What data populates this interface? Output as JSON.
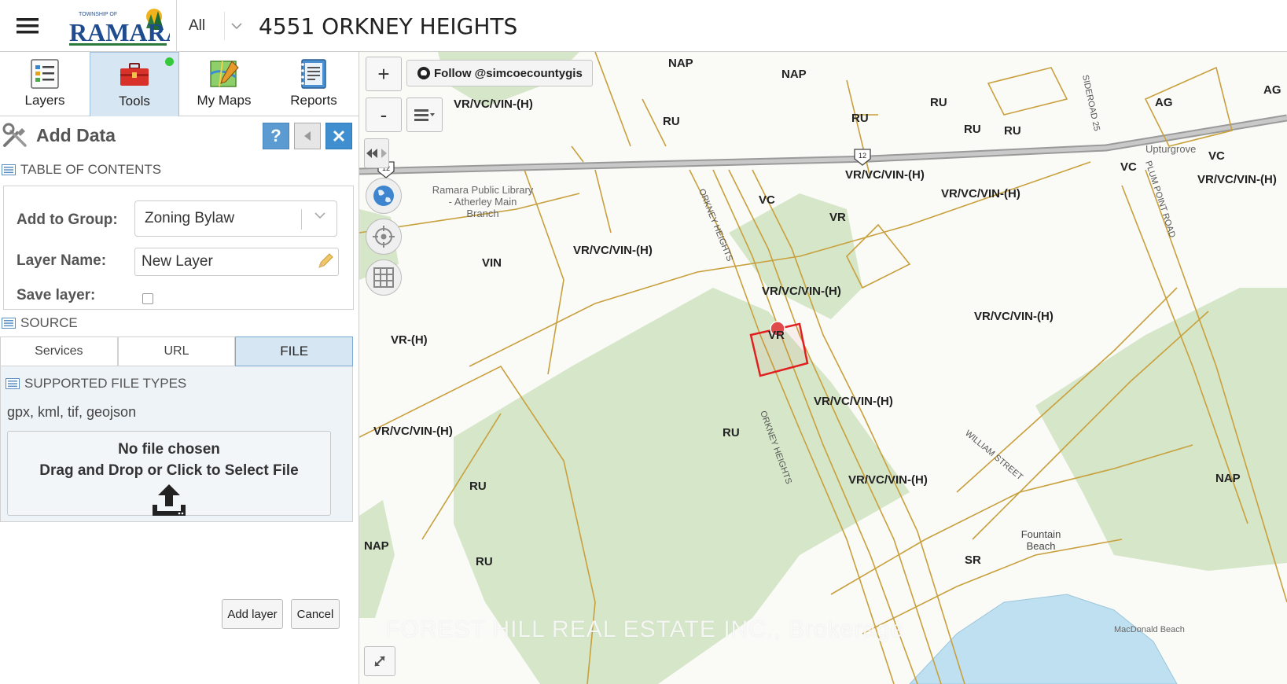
{
  "header": {
    "menu_icon": "hamburger-icon",
    "logo_top": "TOWNSHIP OF",
    "logo_name": "RAMARA",
    "search_scope": "All",
    "search_value": "4551 ORKNEY HEIGHTS"
  },
  "tabs": [
    {
      "label": "Layers",
      "icon": "layers-icon"
    },
    {
      "label": "Tools",
      "icon": "toolbox-icon"
    },
    {
      "label": "My Maps",
      "icon": "my-maps-icon"
    },
    {
      "label": "Reports",
      "icon": "reports-icon"
    }
  ],
  "panel": {
    "title": "Add Data",
    "help_label": "?",
    "toc_header": "TABLE OF CONTENTS",
    "add_to_group_label": "Add to Group:",
    "add_to_group_value": "Zoning Bylaw",
    "layer_name_label": "Layer Name:",
    "layer_name_value": "New Layer",
    "save_layer_label": "Save layer:",
    "source_header": "SOURCE",
    "source_tabs": [
      "Services",
      "URL",
      "FILE"
    ],
    "supported_header": "SUPPORTED FILE TYPES",
    "supported_types": "gpx, kml, tif, geojson",
    "dropzone_line1": "No file chosen",
    "dropzone_line2": "Drag and Drop or Click to Select File",
    "add_layer_button": "Add layer",
    "cancel_button": "Cancel"
  },
  "map": {
    "zoom_in": "+",
    "zoom_out": "-",
    "follow_label": "Follow @simcoecountygis",
    "watermark": "FOREST HILL REAL ESTATE INC., Brokerage",
    "highway_shield": "12",
    "places": [
      "Ramara Public Library - Atherley Main Branch",
      "Fountain Beach",
      "Upturgrove",
      "MacDonald Beach",
      "ORKNEY HEIGHTS",
      "SIDEROAD 25",
      "PLUM POINT ROAD",
      "WILLIAM STREET"
    ],
    "zone_labels": [
      "NAP",
      "NAP",
      "RU",
      "RU",
      "RU",
      "RU",
      "RU",
      "AG",
      "AG",
      "VR/VC/VIN-(H)",
      "VR/VC/VIN-(H)",
      "VR/VC/VIN-(H)",
      "VR/VC/VIN-(H)",
      "VR/VC/VIN-(H)",
      "VR/VC/VIN-(H)",
      "VR/VC/VIN-(H)",
      "VR/VC/VIN-(H)",
      "VR/VC/VIN-(H)",
      "VR/VC/VIN-(H)",
      "VIN",
      "VR-(H)",
      "VC",
      "VC",
      "VC",
      "VR",
      "RU",
      "RU",
      "RU",
      "NAP",
      "NAP",
      "SR",
      "VR"
    ],
    "colors": {
      "parcel_line": "#c8a03c",
      "green_space": "#d3e4c6",
      "water": "#bfe0f0",
      "highlight": "#e02020"
    }
  }
}
